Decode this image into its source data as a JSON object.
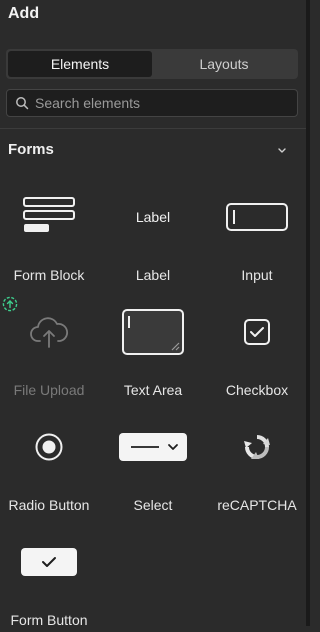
{
  "header": {
    "title": "Add"
  },
  "tabs": [
    {
      "label": "Elements",
      "active": true
    },
    {
      "label": "Layouts",
      "active": false
    }
  ],
  "search": {
    "placeholder": "Search elements",
    "value": ""
  },
  "section": {
    "title": "Forms",
    "expanded": true
  },
  "elements": [
    {
      "label": "Form Block",
      "icon": "form-block-icon"
    },
    {
      "label": "Label",
      "icon": "label-icon",
      "glyph_text": "Label"
    },
    {
      "label": "Input",
      "icon": "input-icon"
    },
    {
      "label": "File Upload",
      "icon": "cloud-upload-icon",
      "disabled": true
    },
    {
      "label": "Text Area",
      "icon": "text-area-icon"
    },
    {
      "label": "Checkbox",
      "icon": "checkbox-icon"
    },
    {
      "label": "Radio Button",
      "icon": "radio-button-icon"
    },
    {
      "label": "Select",
      "icon": "select-icon"
    },
    {
      "label": "reCAPTCHA",
      "icon": "recaptcha-icon"
    },
    {
      "label": "Form Button",
      "icon": "form-button-icon"
    }
  ],
  "colors": {
    "background": "#2b2b2b",
    "accent_upgrade": "#3ecf8e",
    "text": "#e6e6e6",
    "disabled_text": "#7a7a7a"
  }
}
